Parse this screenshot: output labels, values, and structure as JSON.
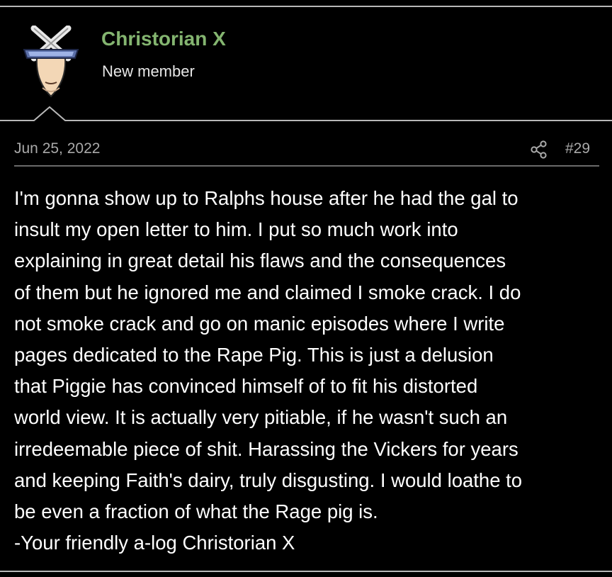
{
  "post": {
    "author": {
      "username": "Christorian X",
      "title": "New member",
      "avatar_icon": "masked-x-face-avatar"
    },
    "date": "Jun 25, 2022",
    "share_icon": "share-icon",
    "number": "#29",
    "body": "I'm gonna show up to Ralphs house after he had the gal to\ninsult my open letter to him. I put so much work into\nexplaining in great detail his flaws and the consequences\nof them but he ignored me and claimed I smoke crack. I do\nnot smoke crack and go on manic episodes where I write\npages dedicated to the Rape Pig. This is just a delusion\nthat Piggie has convinced himself of to fit his distorted\nworld view. It is actually very pitiable, if he wasn't such an\nirredeemable piece of shit. Harassing the Vickers for years\nand keeping Faith's dairy, truly disgusting. I would loathe to\nbe even a fraction of what the Rage pig is.\n-Your friendly a-log Christorian X"
  },
  "colors": {
    "background": "#000000",
    "username": "#84b570",
    "meta_text": "#a9a9a9",
    "body_text": "#ffffff"
  }
}
